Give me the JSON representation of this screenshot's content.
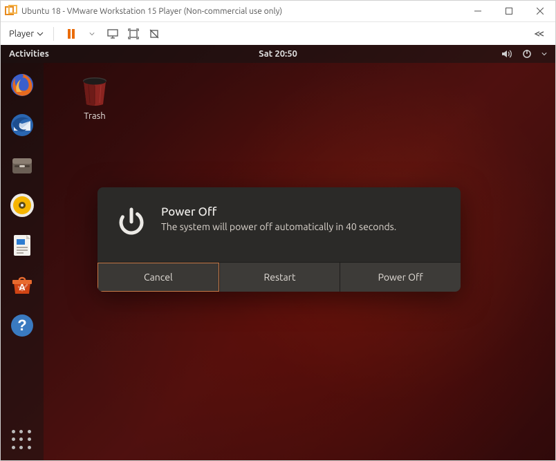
{
  "window": {
    "title": "Ubuntu 18 - VMware Workstation 15 Player (Non-commercial use only)"
  },
  "vmbar": {
    "player_label": "Player"
  },
  "topbar": {
    "activities": "Activities",
    "clock": "Sat 20:50"
  },
  "desktop": {
    "trash_label": "Trash"
  },
  "dialog": {
    "title": "Power Off",
    "message": "The system will power off automatically in 40 seconds.",
    "cancel": "Cancel",
    "restart": "Restart",
    "power_off": "Power Off"
  },
  "dock": {
    "items": [
      "firefox",
      "thunderbird",
      "files",
      "rhythmbox",
      "libreoffice-writer",
      "ubuntu-software",
      "help"
    ]
  }
}
